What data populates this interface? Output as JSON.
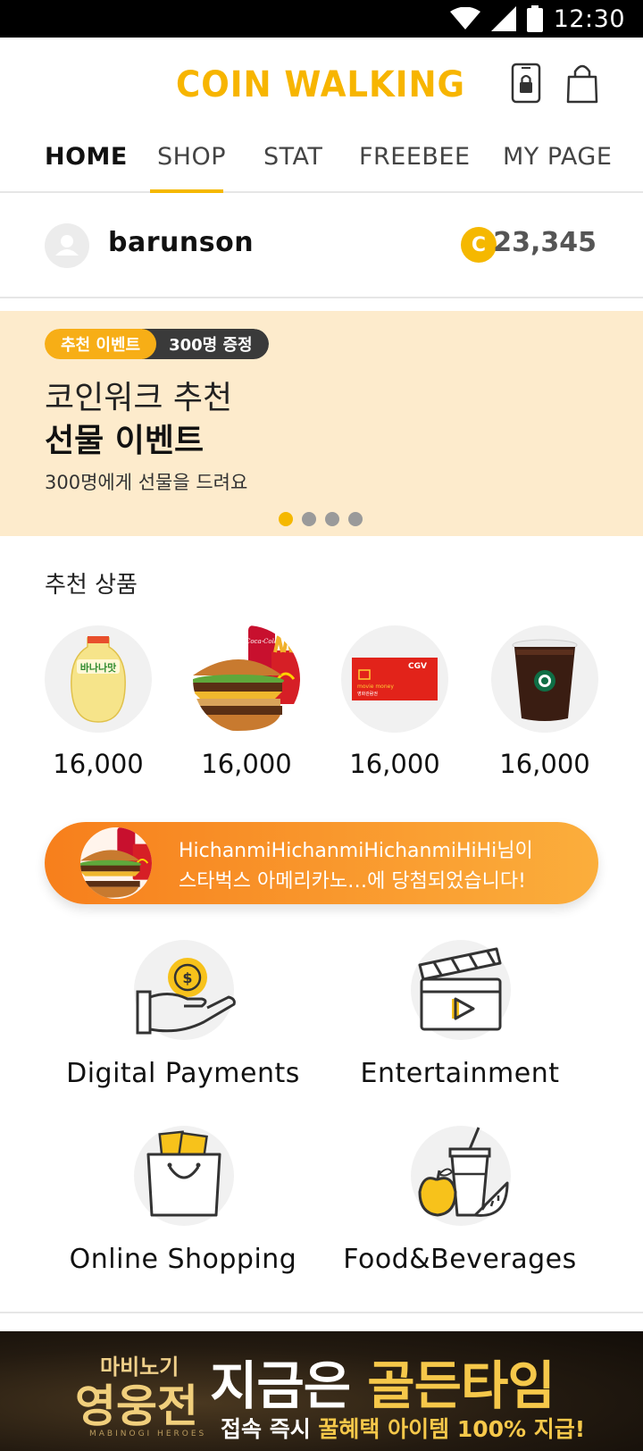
{
  "status_bar": {
    "time": "12:30"
  },
  "header": {
    "logo_text": "COIN WALKING"
  },
  "tabs": [
    {
      "label": "HOME",
      "active": true
    },
    {
      "label": "SHOP",
      "active": false
    },
    {
      "label": "STAT",
      "active": false
    },
    {
      "label": "FREEBEE",
      "active": false
    },
    {
      "label": "MY PAGE",
      "active": false
    }
  ],
  "user": {
    "name": "barunson",
    "coin_symbol": "C",
    "coins": "23,345"
  },
  "banner": {
    "badge_primary": "추천 이벤트",
    "badge_secondary": "300명 증정",
    "title_line1": "코인워크 추천",
    "title_line2": "선물 이벤트",
    "subtitle": "300명에게 선물을 드려요",
    "slides_total": 4,
    "slide_active": 1
  },
  "recommended": {
    "title": "추천 상품",
    "products": [
      {
        "name": "banana-milk",
        "price": "16,000",
        "image_text": "바나나맛"
      },
      {
        "name": "burger-set",
        "price": "16,000",
        "image_text": "Coca-Cola"
      },
      {
        "name": "cgv-movie-money",
        "price": "16,000",
        "image_text": "CGV",
        "image_text2": "movie money",
        "image_text3": "영화관람권"
      },
      {
        "name": "starbucks-coffee",
        "price": "16,000",
        "image_text": ""
      }
    ]
  },
  "ticker": {
    "line1": "HichanmiHichanmiHichanmiHiHi님이",
    "line2": "스타벅스 아메리카노…에 당첨되었습니다!"
  },
  "categories": [
    {
      "label": "Digital Payments",
      "icon": "hand-coin-icon"
    },
    {
      "label": "Entertainment",
      "icon": "clapperboard-icon"
    },
    {
      "label": "Online Shopping",
      "icon": "shopping-bag-icon"
    },
    {
      "label": "Food&Beverages",
      "icon": "food-drink-icon"
    }
  ],
  "ad": {
    "brand_top": "마비노기",
    "brand_main": "영웅전",
    "brand_sub": "MABINOGI HEROES",
    "headline_white": "지금은 ",
    "headline_gold": "골든타임",
    "sub_white1": "접속 즉시 ",
    "sub_gold": "꿀혜택 아이템 100% 지급!"
  },
  "colors": {
    "accent": "#f5b800",
    "banner_bg": "#fdebcc",
    "ticker_start": "#f77f1c",
    "ticker_end": "#fbae3c"
  }
}
